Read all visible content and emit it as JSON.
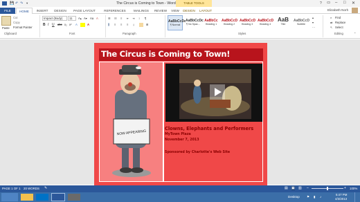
{
  "window": {
    "title": "The Circus is Coming to Town - Word",
    "context_tab_group": "TABLE TOOLS",
    "user": "Elizabeth Norh"
  },
  "tabs": [
    "FILE",
    "HOME",
    "INSERT",
    "DESIGN",
    "PAGE LAYOUT",
    "REFERENCES",
    "MAILINGS",
    "REVIEW",
    "VIEW",
    "DESIGN",
    "LAYOUT"
  ],
  "ribbon": {
    "clipboard": {
      "paste": "Paste",
      "cut": "Cut",
      "copy": "Copy",
      "format_painter": "Format Painter",
      "label": "Clipboard"
    },
    "font": {
      "family": "Impact (Body)",
      "size": "11",
      "label": "Font"
    },
    "paragraph": {
      "label": "Paragraph"
    },
    "styles": {
      "label": "Styles",
      "items": [
        {
          "sample": "AaBbCcDc",
          "name": "¶ Normal"
        },
        {
          "sample": "AaBbCcDc",
          "name": "¶ No Spac..."
        },
        {
          "sample": "AaBbCc",
          "name": "Heading 1"
        },
        {
          "sample": "AaBbCcD",
          "name": "Heading 2"
        },
        {
          "sample": "AaBbCcD",
          "name": "Heading 3"
        },
        {
          "sample": "AaBbCcD",
          "name": "Heading 4"
        },
        {
          "sample": "AaB",
          "name": "Title"
        },
        {
          "sample": "AaBbCcD",
          "name": "Subtitle"
        }
      ]
    },
    "editing": {
      "find": "Find",
      "replace": "Replace",
      "select": "Select",
      "label": "Editing"
    }
  },
  "document": {
    "heading": "The Circus is Coming to Town!",
    "image_caption": "NOW APPEARING",
    "line1": "Clowns, Elephants and Performers",
    "line2": "MyTown Plaza",
    "line3": "November 7, 2013",
    "line4": "Sponsored by Charlotte's Web Site"
  },
  "status": {
    "page": "PAGE 1 OF 1",
    "words": "20 WORDS",
    "zoom": "100%"
  },
  "taskbar": {
    "desktop": "Desktop",
    "time": "5:47 PM",
    "date": "4/3/2013"
  },
  "colors": {
    "accent": "#2b579a",
    "poster_red": "#f04848",
    "heading_bg": "#b8141c",
    "text_dark_red": "#8b0000"
  }
}
